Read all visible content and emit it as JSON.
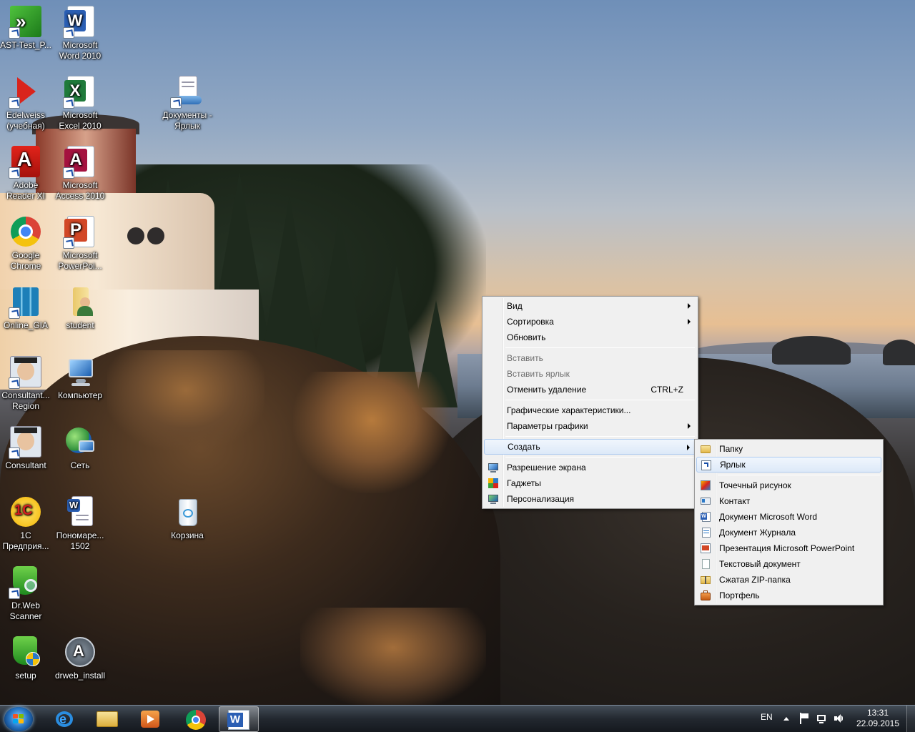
{
  "desktop": {
    "icons": [
      {
        "label": "AST-Test_P...",
        "icon": "ast-test-icon"
      },
      {
        "label": "Microsoft\nWord 2010",
        "icon": "word-icon"
      },
      {
        "label": "Edelweiss\n(учебная)",
        "icon": "edelweiss-icon"
      },
      {
        "label": "Microsoft\nExcel 2010",
        "icon": "excel-icon"
      },
      {
        "label": "Документы -\nЯрлык",
        "icon": "documents-icon"
      },
      {
        "label": "Adobe\nReader XI",
        "icon": "adobe-reader-icon"
      },
      {
        "label": "Microsoft\nAccess 2010",
        "icon": "access-icon"
      },
      {
        "label": "Google\nChrome",
        "icon": "chrome-icon"
      },
      {
        "label": "Microsoft\nPowerPoi...",
        "icon": "powerpoint-icon"
      },
      {
        "label": "Online_GIA",
        "icon": "online-gia-icon"
      },
      {
        "label": "student",
        "icon": "user-folder-icon"
      },
      {
        "label": "Consultant...\nRegion",
        "icon": "consultant-icon"
      },
      {
        "label": "Компьютер",
        "icon": "computer-icon"
      },
      {
        "label": "Consultant",
        "icon": "consultant-icon"
      },
      {
        "label": "Сеть",
        "icon": "network-icon"
      },
      {
        "label": "1С\nПредприя...",
        "icon": "1c-icon"
      },
      {
        "label": "Пономаре...\n1502",
        "icon": "word-document-icon"
      },
      {
        "label": "Корзина",
        "icon": "recycle-bin-icon"
      },
      {
        "label": "Dr.Web\nScanner",
        "icon": "drweb-scanner-icon"
      },
      {
        "label": "setup",
        "icon": "setup-icon"
      },
      {
        "label": "drweb_install",
        "icon": "drweb-install-icon"
      }
    ]
  },
  "context_menu": {
    "items": [
      {
        "label": "Вид",
        "submenu": true
      },
      {
        "label": "Сортировка",
        "submenu": true
      },
      {
        "label": "Обновить"
      },
      {
        "label": "Вставить",
        "disabled": true
      },
      {
        "label": "Вставить ярлык",
        "disabled": true
      },
      {
        "label": "Отменить удаление",
        "shortcut": "CTRL+Z"
      },
      {
        "label": "Графические характеристики..."
      },
      {
        "label": "Параметры графики",
        "submenu": true
      },
      {
        "label": "Создать",
        "submenu": true,
        "highlighted": true
      },
      {
        "label": "Разрешение экрана",
        "icon": "screen-resolution-icon"
      },
      {
        "label": "Гаджеты",
        "icon": "gadgets-icon"
      },
      {
        "label": "Персонализация",
        "icon": "personalization-icon"
      }
    ]
  },
  "create_submenu": {
    "items": [
      {
        "label": "Папку",
        "icon": "folder-icon"
      },
      {
        "label": "Ярлык",
        "icon": "shortcut-icon",
        "highlighted": true
      },
      {
        "label": "Точечный рисунок",
        "icon": "bitmap-icon"
      },
      {
        "label": "Контакт",
        "icon": "contact-icon"
      },
      {
        "label": "Документ Microsoft Word",
        "icon": "word-doc-icon"
      },
      {
        "label": "Документ Журнала",
        "icon": "journal-icon"
      },
      {
        "label": "Презентация Microsoft PowerPoint",
        "icon": "powerpoint-doc-icon"
      },
      {
        "label": "Текстовый документ",
        "icon": "text-doc-icon"
      },
      {
        "label": "Сжатая ZIP-папка",
        "icon": "zip-folder-icon"
      },
      {
        "label": "Портфель",
        "icon": "briefcase-icon"
      }
    ]
  },
  "taskbar": {
    "pinned": [
      "internet-explorer-icon",
      "explorer-icon",
      "media-player-icon",
      "chrome-icon",
      "word-icon"
    ],
    "tray": {
      "language": "EN",
      "time": "13:31",
      "date": "22.09.2015"
    }
  },
  "colors": {
    "menu_bg": "#f0f0f0",
    "menu_highlight": "#dde9f8",
    "taskbar": "#222830"
  }
}
